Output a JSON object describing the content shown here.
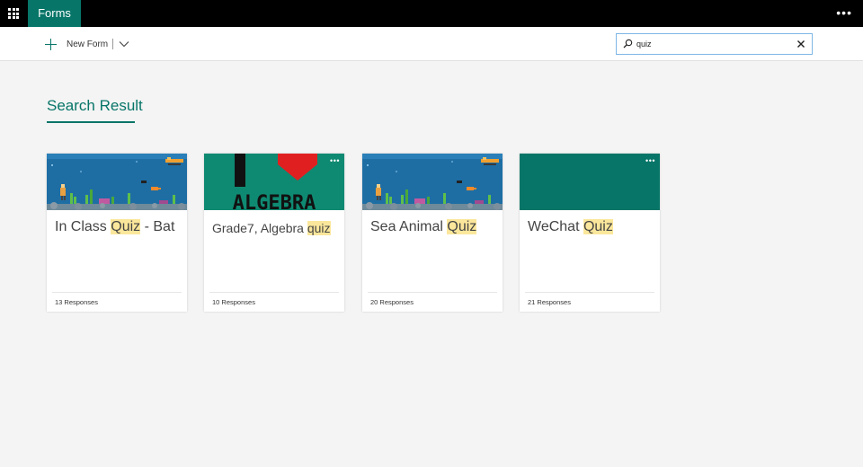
{
  "app": {
    "name": "Forms"
  },
  "toolbar": {
    "new_form_label": "New Form"
  },
  "search": {
    "value": "quiz",
    "placeholder": ""
  },
  "section": {
    "title": "Search Result"
  },
  "cards": [
    {
      "title_before": "In Class ",
      "title_match": "Quiz",
      "title_after": " - Bat",
      "responses": "13 Responses",
      "thumbnail": "underwater-scene"
    },
    {
      "title_before": "Grade7, Algebra ",
      "title_match": "quiz",
      "title_after": "",
      "responses": "10 Responses",
      "thumbnail": "i-love-algebra"
    },
    {
      "title_before": "Sea Animal ",
      "title_match": "Quiz",
      "title_after": "",
      "responses": "20 Responses",
      "thumbnail": "underwater-scene"
    },
    {
      "title_before": "WeChat ",
      "title_match": "Quiz",
      "title_after": "",
      "responses": "21 Responses",
      "thumbnail": "solid-teal"
    }
  ],
  "colors": {
    "accent": "#077568",
    "highlight": "#fbe79b",
    "topbar": "#000000",
    "background": "#f4f4f4",
    "ocean": "#1e6ea4"
  }
}
